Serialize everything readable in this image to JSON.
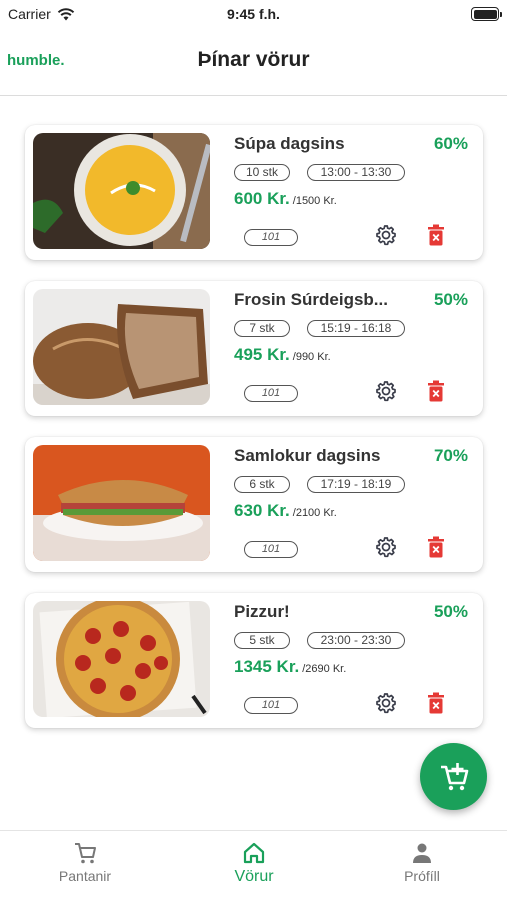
{
  "status_bar": {
    "carrier": "Carrier",
    "time": "9:45 f.h."
  },
  "header": {
    "logo": "humble.",
    "title": "Þínar vörur"
  },
  "products": [
    {
      "name": "Súpa dagsins",
      "discount": "60%",
      "quantity": "10  stk",
      "time_slot": "13:00 - 13:30",
      "price": "600 Kr.",
      "original_price": "/1500 Kr.",
      "code": "101",
      "image": "soup"
    },
    {
      "name": "Frosin Súrdeigsb...",
      "discount": "50%",
      "quantity": "7  stk",
      "time_slot": "15:19 - 16:18",
      "price": "495 Kr.",
      "original_price": "/990 Kr.",
      "code": "101",
      "image": "bread"
    },
    {
      "name": "Samlokur dagsins",
      "discount": "70%",
      "quantity": "6  stk",
      "time_slot": "17:19 - 18:19",
      "price": "630 Kr.",
      "original_price": "/2100 Kr.",
      "code": "101",
      "image": "sandwich"
    },
    {
      "name": "Pizzur!",
      "discount": "50%",
      "quantity": "5  stk",
      "time_slot": "23:00 - 23:30",
      "price": "1345 Kr.",
      "original_price": "/2690 Kr.",
      "code": "101",
      "image": "pizza"
    }
  ],
  "fab": {
    "icon": "add-to-cart-icon"
  },
  "tabbar": {
    "orders_label": "Pantanir",
    "products_label": "Vörur",
    "profile_label": "Prófíll"
  },
  "colors": {
    "accent": "#1aa05a",
    "delete": "#e53935",
    "gear": "#3a3d4a"
  }
}
